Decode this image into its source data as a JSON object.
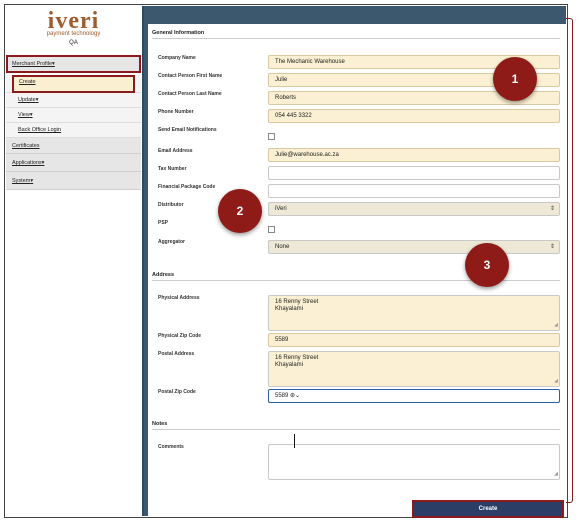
{
  "app": {
    "brand": "iveri",
    "tagline": "payment technology",
    "environment": "QA",
    "brand_color": "#a15a2c",
    "accent_color": "#8b1a1a",
    "header_color": "#3b586f"
  },
  "sidebar": {
    "merchant_profile": "Merchant Profile",
    "create": "Create",
    "update": "Update",
    "view": "View",
    "back_office_login": "Back Office Login",
    "certificates": "Certificates",
    "applications": "Applications",
    "system": "System"
  },
  "form": {
    "general_information": "General Information",
    "company_name_label": "Company Name",
    "company_name_value": "The Mechanic Warehouse",
    "first_name_label": "Contact Person First Name",
    "first_name_value": "Julie",
    "last_name_label": "Contact Person Last Name",
    "last_name_value": "Roberts",
    "phone_label": "Phone Number",
    "phone_value": "054 445 3322",
    "send_email_label": "Send Email Notifications",
    "email_label": "Email Address",
    "email_value": "Julie@warehouse.ac.za",
    "tax_label": "Tax Number",
    "tax_value": "",
    "financial_label": "Financial Package Code",
    "financial_value": "",
    "distributor_label": "Distributor",
    "distributor_value": "iVeri",
    "psp_label": "PSP",
    "aggregator_label": "Aggregator",
    "aggregator_value": "None",
    "address_section": "Address",
    "physical_address_label": "Physical Address",
    "physical_address_line1": "16 Renny Street",
    "physical_address_line2": "Khayalami",
    "physical_zip_label": "Physical Zip Code",
    "physical_zip_value": "5589",
    "postal_address_label": "Postal Address",
    "postal_address_line1": "16 Renny Street",
    "postal_address_line2": "Khayalami",
    "postal_zip_label": "Postal Zip Code",
    "postal_zip_value": "5589",
    "notes_section": "Notes",
    "comments_label": "Comments",
    "comments_value": "",
    "create_button": "Create"
  },
  "annotations": {
    "badge_1": "1",
    "badge_2": "2",
    "badge_3": "3"
  }
}
